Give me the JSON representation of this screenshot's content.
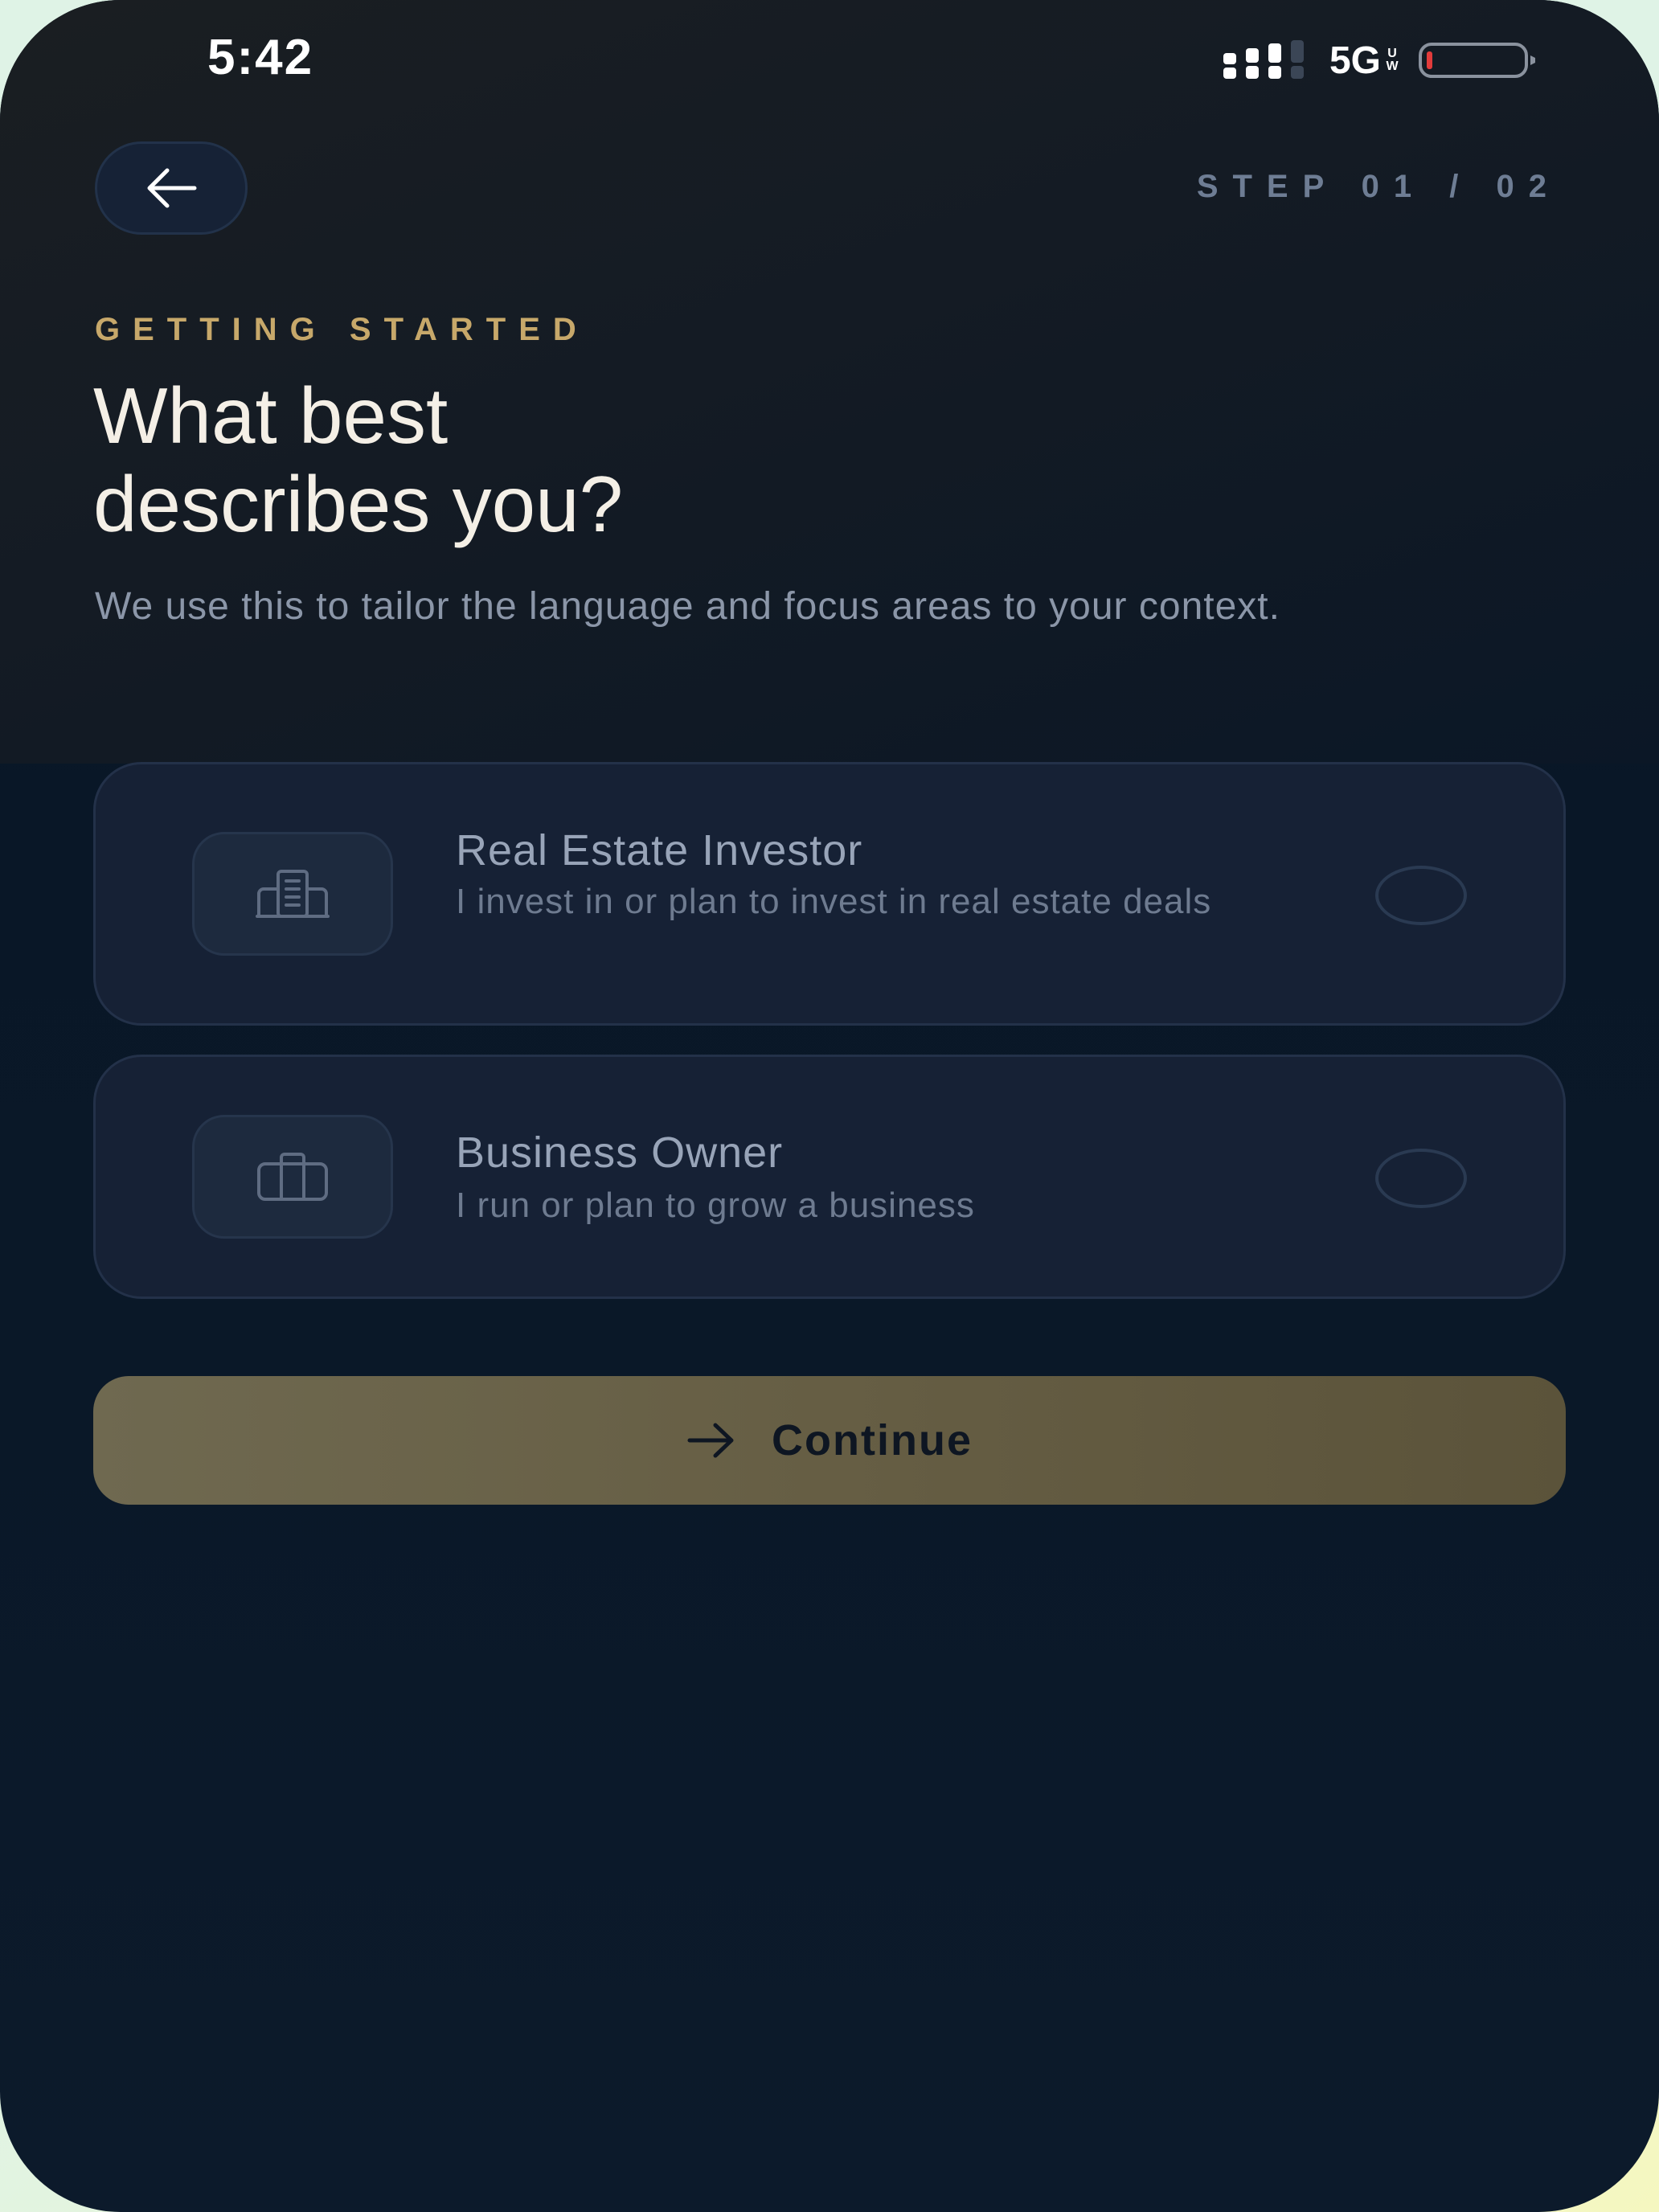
{
  "status_bar": {
    "time": "5:42",
    "network": "5G",
    "network_sub_top": "U",
    "network_sub_bottom": "W",
    "battery_color": "#e23b3b"
  },
  "header": {
    "back_icon": "arrow-left-icon",
    "step": "STEP 01 / 02"
  },
  "intro": {
    "eyebrow": "GETTING STARTED",
    "title_line1": "What best",
    "title_line2": "describes you?",
    "subtitle": "We use this to tailor the language and focus areas to your context."
  },
  "options": [
    {
      "icon": "building-icon",
      "title": "Real Estate Investor",
      "description": "I invest in or plan to invest in real estate deals"
    },
    {
      "icon": "briefcase-icon",
      "title": "Business Owner",
      "description": "I run or plan to grow a business"
    }
  ],
  "continue_button": {
    "icon": "arrow-right-icon",
    "label": "Continue"
  },
  "colors": {
    "accent_gold": "#c7a86a",
    "background": "#0a1828",
    "card": "#162135"
  }
}
